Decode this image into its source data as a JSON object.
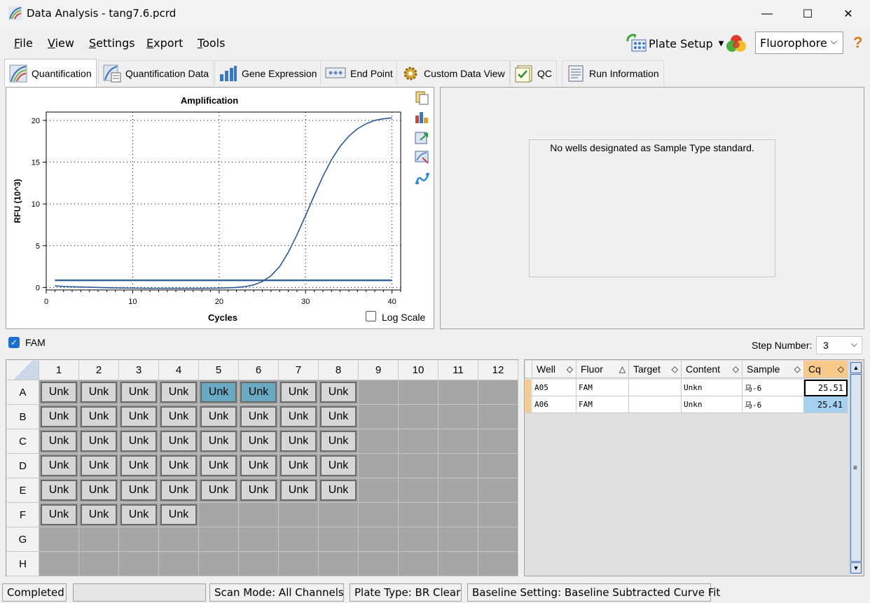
{
  "window": {
    "title": "Data Analysis - tang7.6.pcrd",
    "minimize": "—",
    "maximize": "☐",
    "close": "✕"
  },
  "menu": {
    "file": "File",
    "view": "View",
    "settings": "Settings",
    "export": "Export",
    "tools": "Tools"
  },
  "toolbar": {
    "plate_setup": "Plate Setup",
    "fluor_select": "Fluorophore",
    "help": "?"
  },
  "tabs": [
    "Quantification",
    "Quantification Data",
    "Gene Expression",
    "End Point",
    "Custom Data View",
    "QC",
    "Run Information"
  ],
  "chart": {
    "log_scale_label": "Log Scale"
  },
  "chart_data": {
    "type": "line",
    "title": "Amplification",
    "xlabel": "Cycles",
    "ylabel": "RFU (10^3)",
    "xlim": [
      0,
      41
    ],
    "ylim": [
      -0.3,
      21
    ],
    "xticks": [
      0,
      10,
      20,
      30,
      40
    ],
    "yticks": [
      0,
      5,
      10,
      15,
      20
    ],
    "grid": true,
    "series": [
      {
        "x": [
          1,
          2,
          4,
          6,
          8,
          10,
          12,
          14,
          16,
          18,
          20,
          22,
          23,
          24,
          25,
          26,
          27,
          28,
          29,
          30,
          31,
          32,
          33,
          34,
          35,
          36,
          37,
          38,
          39,
          40
        ],
        "values": [
          0.2,
          0.1,
          0.05,
          0.0,
          -0.05,
          -0.08,
          -0.1,
          -0.1,
          -0.1,
          -0.1,
          -0.08,
          0.0,
          0.1,
          0.3,
          0.7,
          1.4,
          2.5,
          4.2,
          6.3,
          8.6,
          11.0,
          13.3,
          15.3,
          16.9,
          18.1,
          19.0,
          19.6,
          20.0,
          20.2,
          20.3
        ]
      },
      {
        "x": [
          1,
          40
        ],
        "values": [
          0.85,
          0.85
        ]
      }
    ]
  },
  "standard_panel": {
    "message": "No wells designated as Sample Type standard."
  },
  "fam": {
    "label": "FAM",
    "step_label": "Step Number:",
    "step_value": "3"
  },
  "plate": {
    "columns": [
      "1",
      "2",
      "3",
      "4",
      "5",
      "6",
      "7",
      "8",
      "9",
      "10",
      "11",
      "12"
    ],
    "rows": [
      "A",
      "B",
      "C",
      "D",
      "E",
      "F",
      "G",
      "H"
    ],
    "well_label": "Unk",
    "filled": [
      8,
      8,
      8,
      8,
      8,
      4,
      0,
      0
    ],
    "selected": [
      "A5",
      "A6"
    ]
  },
  "results": {
    "headers": [
      "Well",
      "Fluor",
      "Target",
      "Content",
      "Sample",
      "Cq"
    ],
    "rows": [
      {
        "well": "A05",
        "fluor": "FAM",
        "target": "",
        "content": "Unkn",
        "sample": "马-6",
        "cq": "25.51"
      },
      {
        "well": "A06",
        "fluor": "FAM",
        "target": "",
        "content": "Unkn",
        "sample": "马-6",
        "cq": "25.41"
      }
    ]
  },
  "status": {
    "state": "Completed",
    "scan_mode": "Scan Mode: All Channels",
    "plate_type": "Plate Type: BR Clear",
    "baseline": "Baseline Setting: Baseline Subtracted Curve Fit"
  },
  "colors": {
    "curve": "#2a5a95",
    "selected_well": "#6aa9c2",
    "cq_highlight": "#a6d0f0",
    "row_marker": "#f8c98a"
  }
}
